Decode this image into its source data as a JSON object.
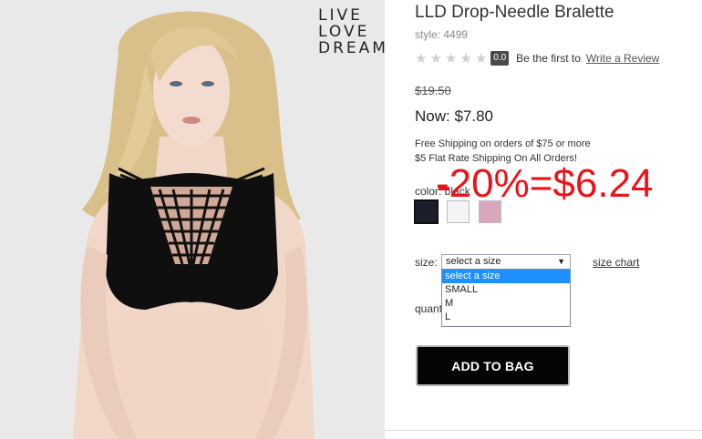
{
  "brand": {
    "logo_lines": [
      "LIVE",
      "LOVE",
      "DREAM"
    ]
  },
  "product": {
    "title": "LLD Drop-Needle Bralette",
    "style": "style: 4499",
    "rating": {
      "stars_filled": 0,
      "stars_total": 5,
      "score": "0.0",
      "prompt": "Be the first to",
      "review_link": "Write a Review"
    },
    "was_price": "$19.50",
    "now_price": "Now: $7.80",
    "shipping_line1": "Free Shipping on orders of $75 or more",
    "shipping_line2": "$5 Flat Rate Shipping On All Orders!",
    "color_label": "color: black",
    "swatches": [
      {
        "name": "black",
        "color": "#1c1f2b",
        "selected": true
      },
      {
        "name": "white",
        "color": "#f3f4f6",
        "selected": false
      },
      {
        "name": "pink",
        "color": "#d9a7bd",
        "selected": false
      }
    ],
    "size_label": "size:",
    "size_select_value": "select a size",
    "size_options": [
      "select a size",
      "SMALL",
      "M",
      "L"
    ],
    "size_chart": "size chart",
    "quantity_label": "quantity:",
    "add_to_bag": "ADD TO BAG"
  },
  "annotation": {
    "discount_text": "-20%=$6.24",
    "color": "#e8141b"
  }
}
